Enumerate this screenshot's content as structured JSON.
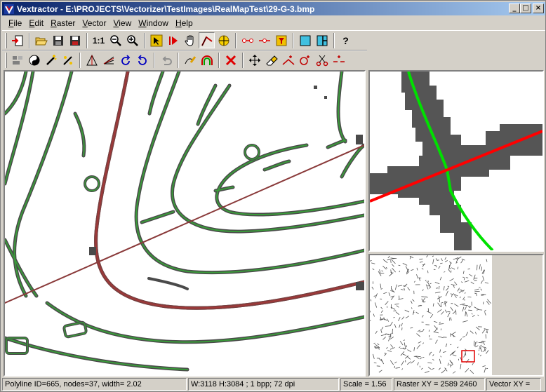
{
  "window": {
    "title": "Vextractor - E:\\PROJECTS\\Vectorizer\\TestImages\\RealMapTest\\29-G-3.bmp",
    "minimize": "_",
    "maximize": "□",
    "close": "×"
  },
  "menu": {
    "items": [
      {
        "label": "File",
        "key": "F",
        "rest": "ile"
      },
      {
        "label": "Edit",
        "key": "E",
        "rest": "dit"
      },
      {
        "label": "Raster",
        "key": "R",
        "rest": "aster"
      },
      {
        "label": "Vector",
        "key": "V",
        "rest": "ector"
      },
      {
        "label": "View",
        "key": "V",
        "rest": "iew"
      },
      {
        "label": "Window",
        "key": "W",
        "rest": "indow"
      },
      {
        "label": "Help",
        "key": "H",
        "rest": "elp"
      }
    ]
  },
  "toolbar": {
    "zoom_1to1": "1:1",
    "help": "?"
  },
  "status": {
    "polyline": "Polyline ID=665, nodes=37, width= 2.02",
    "image_info": "W:3118 H:3084 ; 1 bpp; 72 dpi",
    "scale": "Scale =  1.56",
    "raster_xy": "Raster XY = 2589 2460",
    "vector_xy": "Vector XY ="
  },
  "colors": {
    "contour_green": "#3a9a3a",
    "raster_dark": "#5a5a5a",
    "selected_red": "#ff0000",
    "vector_bright_green": "#00e000",
    "title_blue": "#0a246a"
  }
}
